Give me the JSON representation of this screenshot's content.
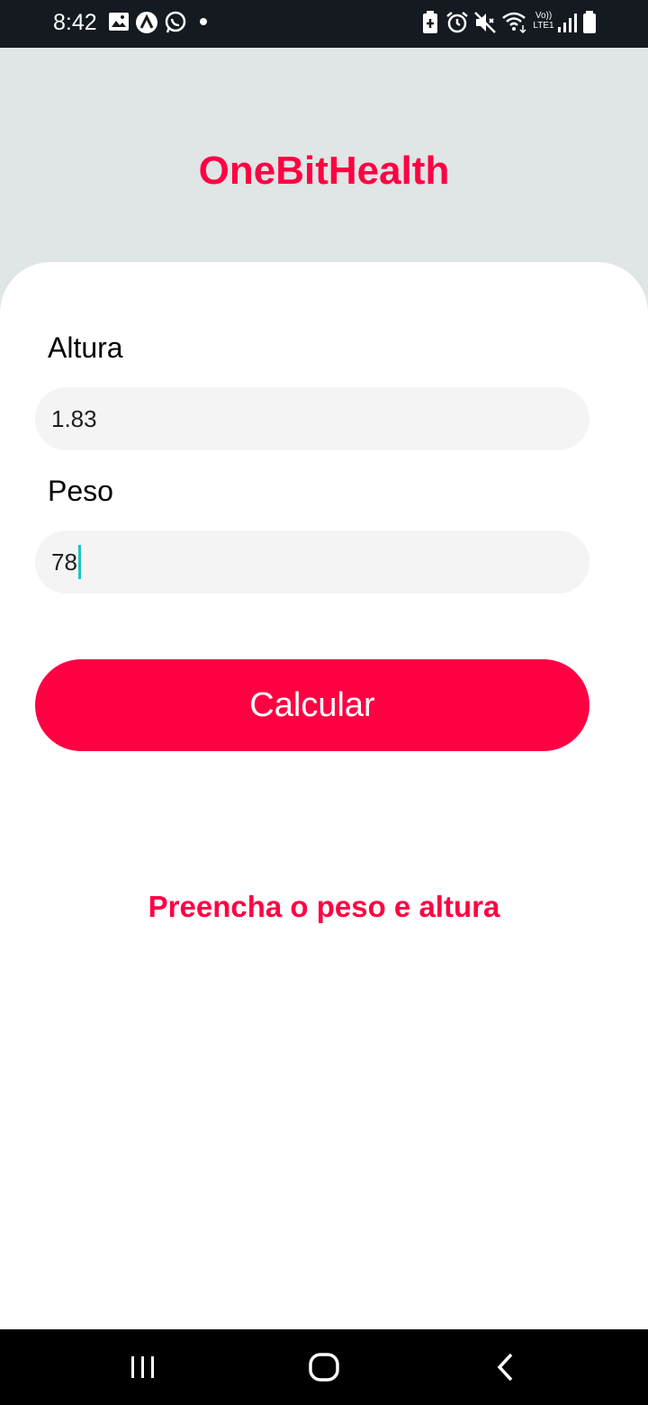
{
  "status_bar": {
    "time": "8:42",
    "left_icons": [
      "gallery-icon",
      "app-icon",
      "whatsapp-icon",
      "dot-icon"
    ],
    "right_icons": [
      "battery-saver-icon",
      "alarm-icon",
      "mute-icon",
      "wifi-icon",
      "volte-icon",
      "signal-icon",
      "battery-icon"
    ],
    "volte_label": "Vo))",
    "lte_label": "LTE1"
  },
  "app": {
    "title": "OneBitHealth",
    "accent_color": "#ff0043",
    "header_bg": "#e0e5e5"
  },
  "form": {
    "height_label": "Altura",
    "height_value": "1.83",
    "weight_label": "Peso",
    "weight_value": "78",
    "weight_focused": true,
    "calculate_label": "Calcular",
    "message": "Preencha o peso e altura"
  },
  "nav_bar": {
    "buttons": [
      "recent-apps-icon",
      "home-icon",
      "back-icon"
    ]
  }
}
